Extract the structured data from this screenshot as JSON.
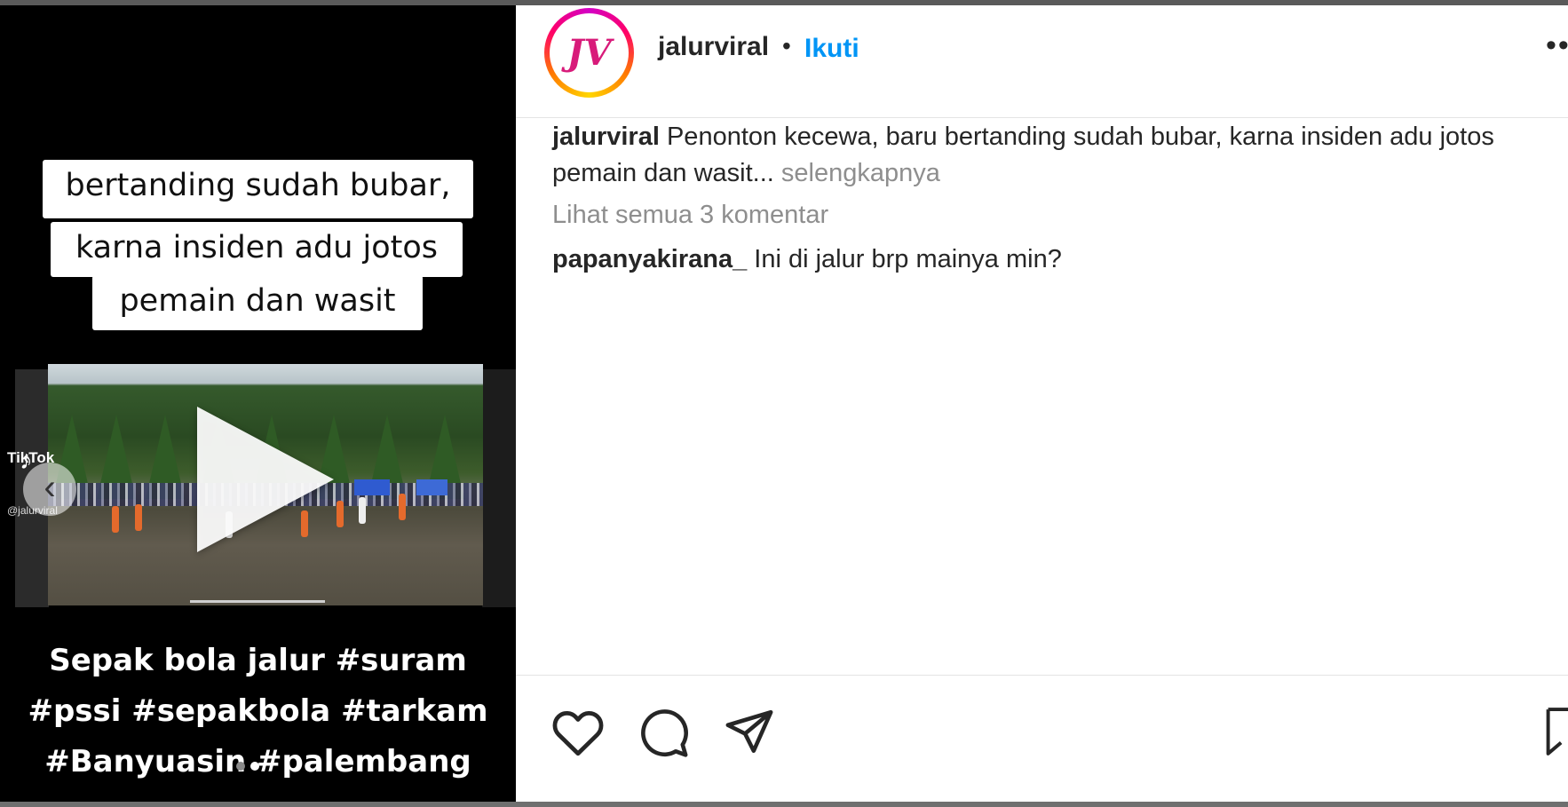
{
  "media": {
    "overlay_lines": [
      "bertanding sudah bubar,",
      "karna insiden adu jotos",
      "pemain dan wasit"
    ],
    "bottom_lines": [
      "Sepak bola jalur #suram",
      "#pssi #sepakbola #tarkam",
      "#Banyuasin #palembang"
    ],
    "watermark_brand": "TikTok",
    "watermark_user": "@jalurviral"
  },
  "header": {
    "username": "jalurviral",
    "separator": "•",
    "follow_label": "Ikuti"
  },
  "caption": {
    "username": "jalurviral",
    "text": "Penonton kecewa, baru bertanding sudah bubar, karna insiden adu jotos",
    "text2": "pemain dan wasit...",
    "more_label": "selengkapnya"
  },
  "comments": {
    "view_all_label": "Lihat semua 3 komentar",
    "items": [
      {
        "username": "papanyakirana_",
        "text": "Ini di jalur brp mainya min?"
      }
    ]
  },
  "colors": {
    "accent": "#0095f6",
    "text": "#262626",
    "muted": "#8e8e8e"
  },
  "icons": [
    "heart-icon",
    "comment-icon",
    "share-icon",
    "bookmark-icon",
    "play-icon",
    "chevron-left-icon",
    "more-icon"
  ]
}
